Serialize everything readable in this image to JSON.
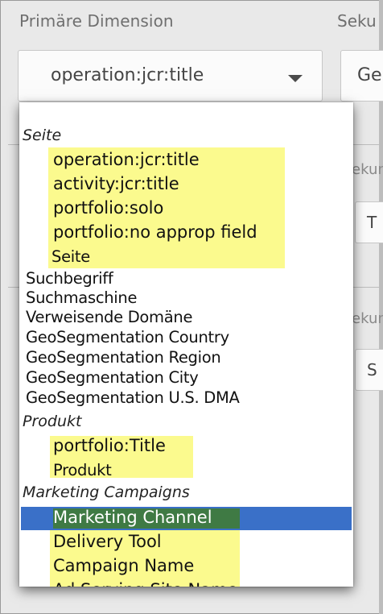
{
  "panel": {
    "primary_label": "Primäre Dimension",
    "secondary_label": "Seku",
    "primary_value": "operation:jcr:title",
    "secondary_value": "Ge",
    "side_label_1": "ekun",
    "side_value_1": "T",
    "side_label_2": "ekun",
    "side_value_2": "S"
  },
  "dropdown": {
    "groups": [
      {
        "header": "Seite",
        "items": [
          "operation:jcr:title",
          "activity:jcr:title",
          "portfolio:solo",
          "portfolio:no approp field",
          "Seite"
        ]
      },
      {
        "header": "",
        "items": [
          "Suchbegriff",
          "Suchmaschine",
          "Verweisende Domäne",
          "GeoSegmentation Country",
          "GeoSegmentation Region",
          "GeoSegmentation City",
          "GeoSegmentation U.S. DMA"
        ]
      },
      {
        "header": "Produkt",
        "items": [
          "portfolio:Title",
          "Produkt"
        ]
      },
      {
        "header": "Marketing Campaigns",
        "items": [
          "Marketing Channel",
          "Delivery Tool",
          "Campaign Name",
          "Ad Serving Site Name"
        ]
      }
    ],
    "selected_item": "Marketing Channel",
    "highlight_color": "#fbfa8e",
    "selection_color": "#3a70c8"
  }
}
